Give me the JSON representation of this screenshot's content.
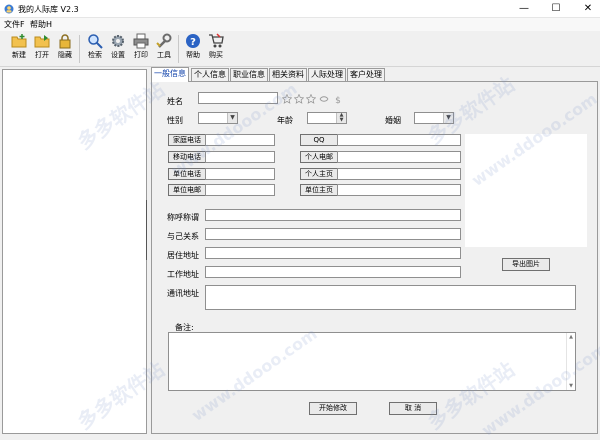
{
  "window": {
    "title": "我的人际库 V2.3",
    "minimize": "—",
    "maximize": "☐",
    "close": "✕"
  },
  "menu": [
    "文件F",
    "帮助H"
  ],
  "toolbar": [
    {
      "label": "新建",
      "icon": "new-folder-icon"
    },
    {
      "label": "打开",
      "icon": "open-folder-icon"
    },
    {
      "label": "隐藏",
      "icon": "lock-icon"
    },
    {
      "label": "检索",
      "icon": "search-icon"
    },
    {
      "label": "设置",
      "icon": "gear-icon"
    },
    {
      "label": "打印",
      "icon": "printer-icon"
    },
    {
      "label": "工具",
      "icon": "wrench-icon"
    },
    {
      "label": "帮助",
      "icon": "help-icon"
    },
    {
      "label": "购买",
      "icon": "cart-icon"
    }
  ],
  "tabs": [
    "一般信息",
    "个人信息",
    "职业信息",
    "相关资料",
    "人际处理",
    "客户处理"
  ],
  "form": {
    "name_label": "姓名",
    "gender_label": "性别",
    "age_label": "年龄",
    "marriage_label": "婚姻",
    "phone_buttons": [
      "家庭电话",
      "移动电话",
      "单位电话",
      "单位电邮"
    ],
    "net_buttons": [
      "QQ",
      "个人电邮",
      "个人主页",
      "单位主页"
    ],
    "title_label": "称呼称谓",
    "relation_label": "与己关系",
    "residence_label": "居住地址",
    "work_label": "工作地址",
    "mail_label": "通讯地址",
    "note_label": "备注:",
    "export_button": "导出图片",
    "edit_button": "开始修改",
    "cancel_button": "取 消"
  },
  "watermark": [
    "多多软件站",
    "www.ddooo.com"
  ],
  "colors": {
    "accent_tab": "#0b3ea8",
    "star": "#9a9a9a"
  }
}
